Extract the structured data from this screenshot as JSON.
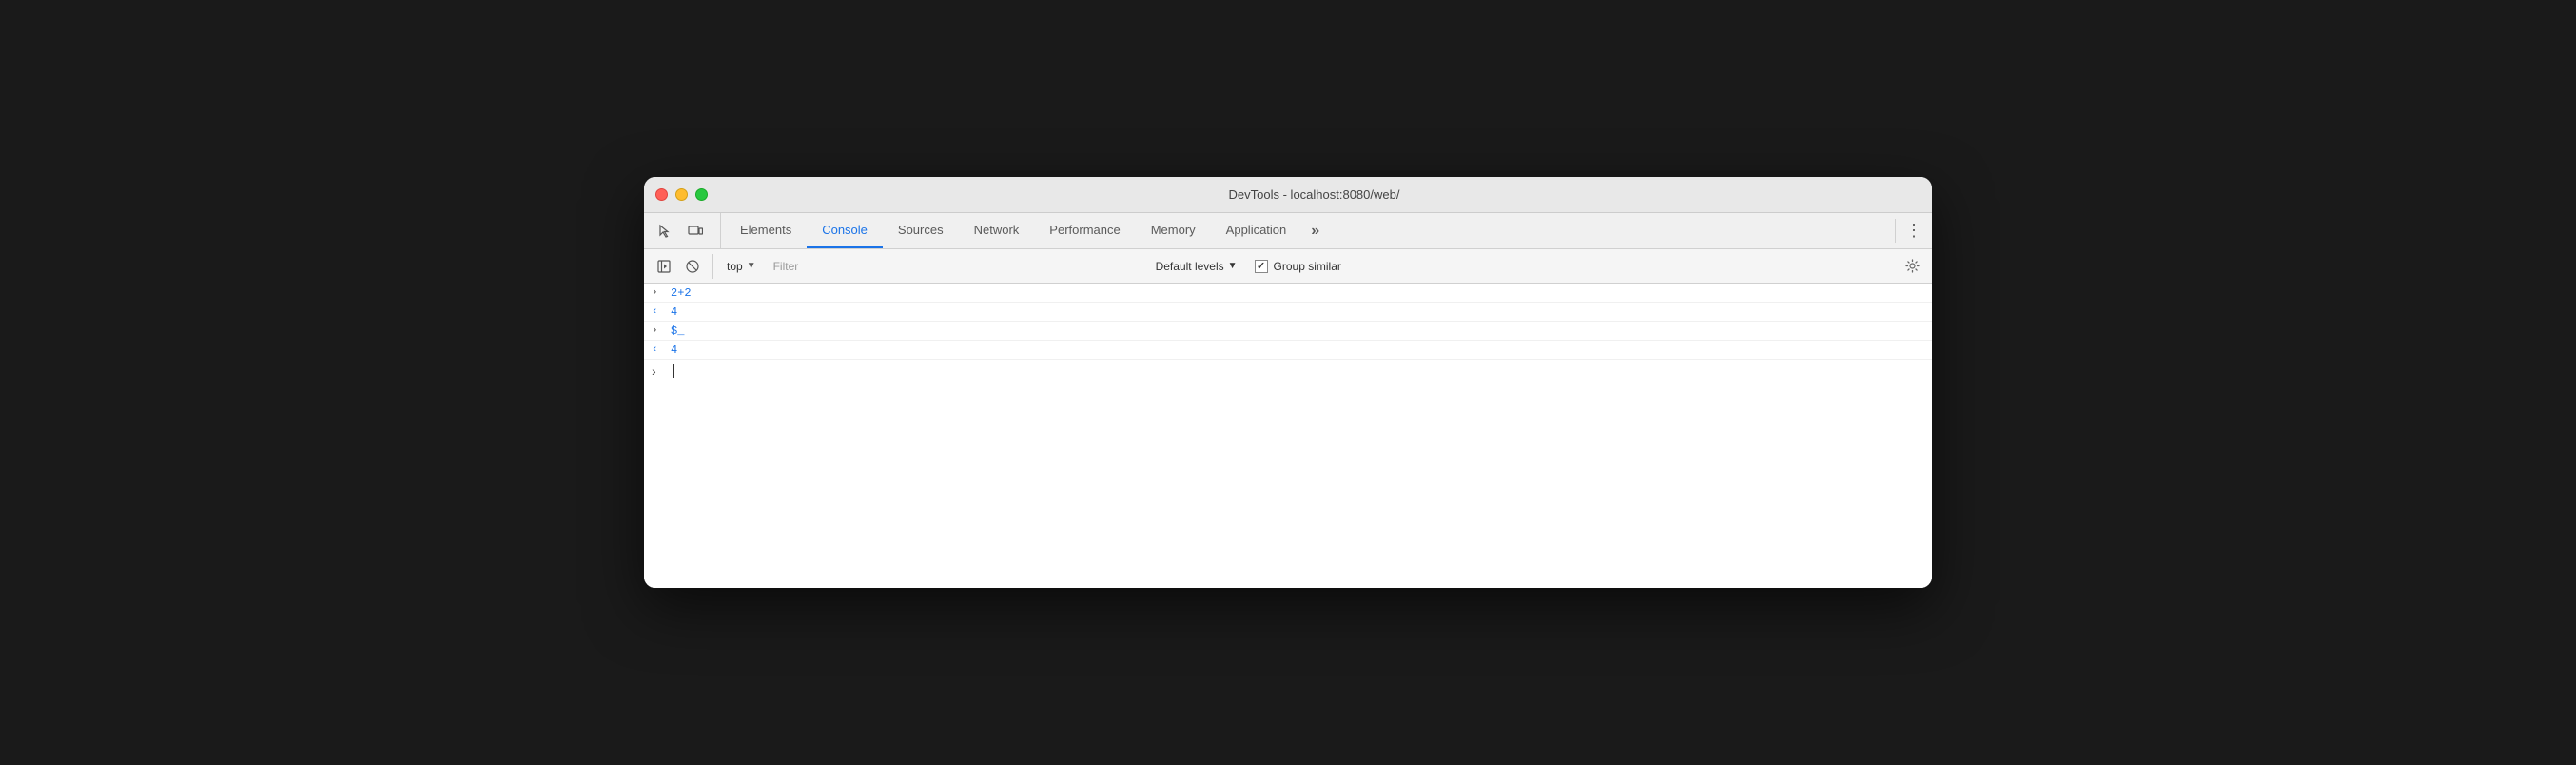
{
  "window": {
    "title": "DevTools - localhost:8080/web/"
  },
  "tabs_bar": {
    "inspect_icon": "⬜",
    "device_icon": "⧉",
    "tabs": [
      {
        "id": "elements",
        "label": "Elements",
        "active": false
      },
      {
        "id": "console",
        "label": "Console",
        "active": true
      },
      {
        "id": "sources",
        "label": "Sources",
        "active": false
      },
      {
        "id": "network",
        "label": "Network",
        "active": false
      },
      {
        "id": "performance",
        "label": "Performance",
        "active": false
      },
      {
        "id": "memory",
        "label": "Memory",
        "active": false
      },
      {
        "id": "application",
        "label": "Application",
        "active": false
      }
    ],
    "more_label": "»",
    "overflow_label": "⋮"
  },
  "console_toolbar": {
    "sidebar_icon": "▶|",
    "clear_icon": "🚫",
    "context_label": "top",
    "context_dropdown_arrow": "▼",
    "filter_placeholder": "Filter",
    "default_levels_label": "Default levels",
    "levels_arrow": "▼",
    "group_similar_label": "Group similar",
    "settings_icon": "⚙"
  },
  "console_rows": [
    {
      "id": "row1",
      "arrow": ">",
      "arrow_type": "right",
      "content": "2+2",
      "content_color": "blue"
    },
    {
      "id": "row2",
      "arrow": "<",
      "arrow_type": "left",
      "content": "4",
      "content_color": "blue"
    },
    {
      "id": "row3",
      "arrow": ">",
      "arrow_type": "right",
      "content": "$_",
      "content_color": "blue"
    },
    {
      "id": "row4",
      "arrow": "<",
      "arrow_type": "left",
      "content": "4",
      "content_color": "blue"
    }
  ],
  "input_row": {
    "arrow": ">",
    "placeholder": ""
  }
}
